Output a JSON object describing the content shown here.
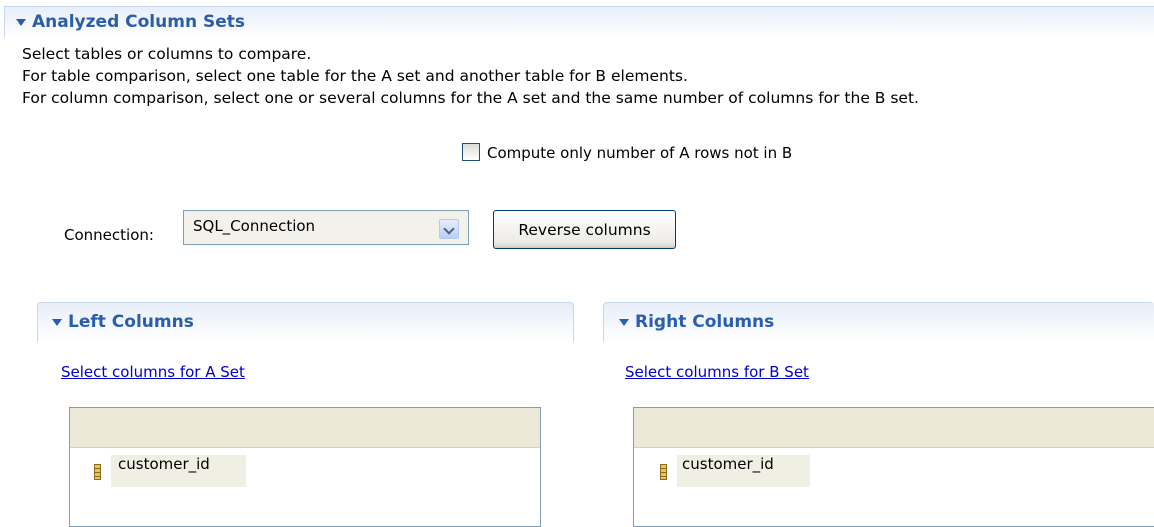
{
  "section": {
    "title": "Analyzed Column Sets",
    "desc_line1": "Select tables or columns to compare.",
    "desc_line2": "For table comparison, select one table for the A set and another table for B elements.",
    "desc_line3": "For column comparison, select one or several columns for the A set and the same number of columns for the B set."
  },
  "option": {
    "checkbox_label": "Compute only number of A rows not in B",
    "checked": false
  },
  "connection": {
    "label": "Connection:",
    "value": "SQL_Connection"
  },
  "reverse_button": "Reverse columns",
  "left": {
    "title": "Left Columns",
    "link": "Select columns for A Set",
    "rows": [
      "customer_id"
    ]
  },
  "right": {
    "title": "Right Columns",
    "link": "Select columns for B Set",
    "rows": [
      "customer_id"
    ]
  },
  "colors": {
    "header_text": "#2a5eaa",
    "link": "#0000cc",
    "header_bg": "#e7eef8"
  },
  "icons": {
    "twisty": "triangle-down",
    "column": "column-icon"
  }
}
